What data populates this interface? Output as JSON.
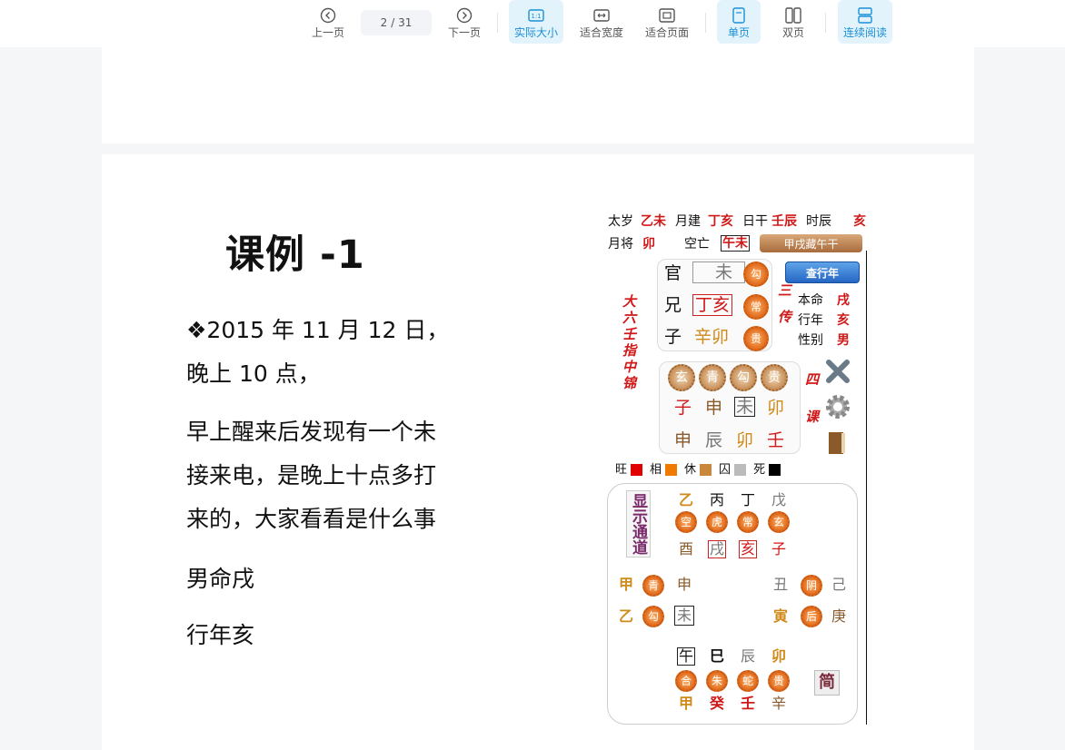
{
  "toolbar": {
    "prev_label": "上一页",
    "next_label": "下一页",
    "current_page": "2",
    "total_pages": "/ 31",
    "actual_size_label": "实际大小",
    "fit_width_label": "适合宽度",
    "fit_page_label": "适合页面",
    "single_page_label": "单页",
    "double_page_label": "双页",
    "continuous_label": "连续阅读",
    "accent_color": "#1a8fd6"
  },
  "document": {
    "title": "课例 -1",
    "lines": [
      "❖2015 年 11 月 12 日，",
      "晚上 10 点，",
      "早上醒来后发现有一个未",
      "接来电，是晚上十点多打",
      "来的，大家看看是什么事",
      "男命戌",
      "行年亥"
    ]
  },
  "chart": {
    "header": {
      "taisui_label": "太岁",
      "taisui": "乙未",
      "yuejian_label": "月建",
      "yuejian": "丁亥",
      "rigan_label": "日干",
      "rigan": "壬辰",
      "shichen_label": "时辰",
      "shichen": "亥",
      "yuejiang_label": "月将",
      "yuejiang": "卯",
      "kongwang_label": "空亡",
      "kongwang": "午未",
      "banner": "甲戌藏午干"
    },
    "sanchuan": {
      "rows": [
        {
          "liuqin": "官",
          "zhi": "未",
          "god": "勾"
        },
        {
          "liuqin": "兄",
          "zhi": "丁亥",
          "god": "常"
        },
        {
          "liuqin": "子",
          "zhi": "辛卯",
          "god": "贵"
        }
      ],
      "button": "查行年",
      "label": "三传"
    },
    "side_title": "大六壬指中锦",
    "benming": {
      "benming_label": "本命",
      "benming": "戌",
      "xingnian_label": "行年",
      "xingnian": "亥",
      "xingbie_label": "性别",
      "xingbie": "男"
    },
    "sike": {
      "gods": [
        "玄",
        "青",
        "勾",
        "贵"
      ],
      "top": [
        "子",
        "申",
        "未",
        "卯"
      ],
      "bottom": [
        "申",
        "辰",
        "卯",
        "壬"
      ],
      "label": "四课"
    },
    "wangxiang": {
      "labels": [
        "旺",
        "相",
        "休",
        "囚",
        "死"
      ],
      "colors": [
        "#e00000",
        "#f07a00",
        "#c8873a",
        "#bbbbbb",
        "#000000"
      ]
    },
    "tianpan": {
      "side_button": "显示通道",
      "top_gan": [
        "乙",
        "丙",
        "丁",
        "戊"
      ],
      "top_gods": [
        "空",
        "虎",
        "常",
        "玄"
      ],
      "top_zhi": [
        "酉",
        "戌",
        "亥",
        "子"
      ],
      "left_gan": [
        "甲",
        "乙"
      ],
      "left_gods": [
        "青",
        "勾"
      ],
      "left_zhi": [
        "申",
        "未"
      ],
      "right_zhi": [
        "丑",
        "寅"
      ],
      "right_gods": [
        "阴",
        "后"
      ],
      "right_gan": [
        "己",
        "庚"
      ],
      "bottom_zhi": [
        "午",
        "巳",
        "辰",
        "卯"
      ],
      "bottom_gods": [
        "合",
        "朱",
        "蛇",
        "贵"
      ],
      "bottom_gan": [
        "甲",
        "癸",
        "壬",
        "辛"
      ],
      "corner_icon": "简"
    }
  }
}
